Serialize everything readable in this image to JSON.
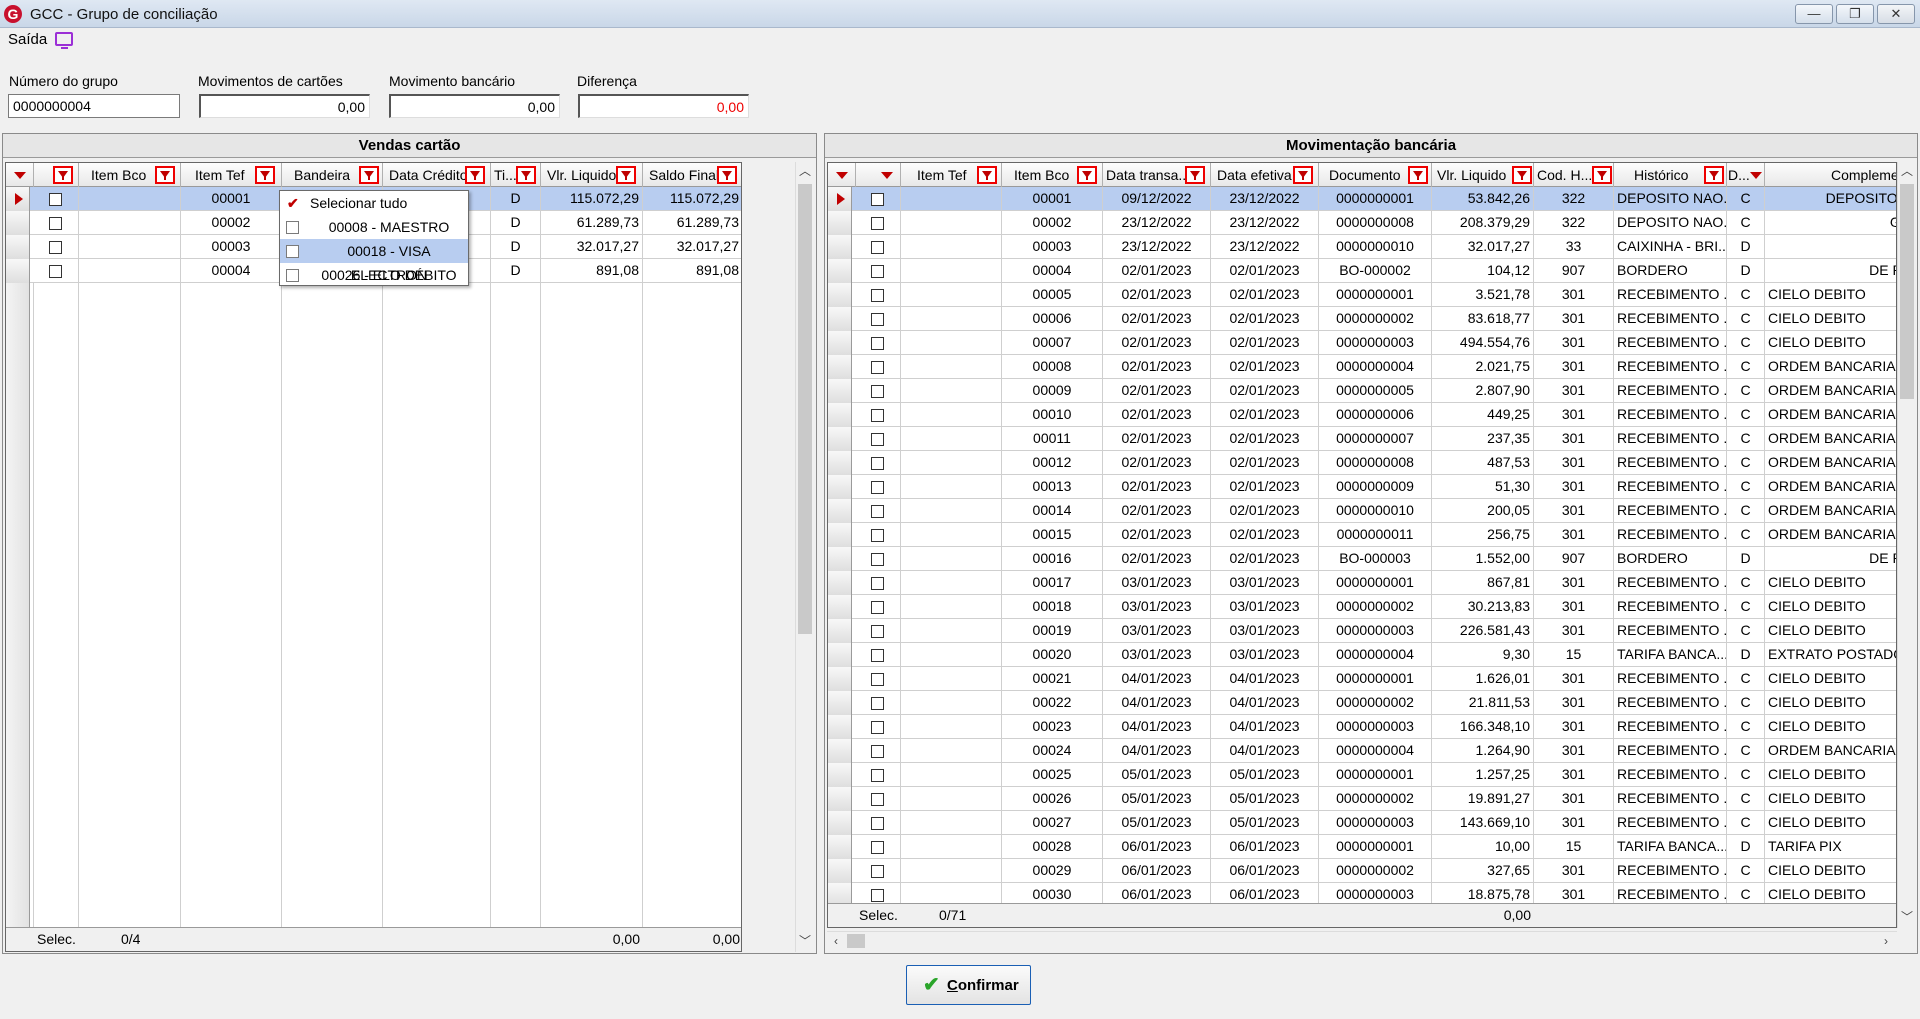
{
  "window": {
    "logo": "G",
    "title": "GCC - Grupo de conciliação",
    "controls": [
      "—",
      "❐",
      "✕"
    ]
  },
  "menu": {
    "saida": "Saída"
  },
  "fields": {
    "numero_label": "Número do grupo",
    "numero_value": "0000000004",
    "mov_cartoes_label": "Movimentos de cartões",
    "mov_cartoes_value": "0,00",
    "mov_bancario_label": "Movimento bancário",
    "mov_bancario_value": "0,00",
    "diferenca_label": "Diferença",
    "diferenca_value": "0,00"
  },
  "vendas": {
    "title": "Vendas cartão",
    "columns": [
      "Item Bco",
      "Item Tef",
      "Bandeira",
      "Data Crédito",
      "Ti...",
      "Vlr. Liquido",
      "Saldo Final"
    ],
    "rows": [
      {
        "item_tef": "00001",
        "tipo": "D",
        "vlr": "115.072,29",
        "saldo": "115.072,29"
      },
      {
        "item_tef": "00002",
        "tipo": "D",
        "vlr": "61.289,73",
        "saldo": "61.289,73"
      },
      {
        "item_tef": "00003",
        "tipo": "D",
        "vlr": "32.017,27",
        "saldo": "32.017,27"
      },
      {
        "item_tef": "00004",
        "tipo": "D",
        "vlr": "891,08",
        "saldo": "891,08"
      }
    ],
    "footer": {
      "selec": "Selec.",
      "count": "0/4",
      "vlr": "0,00",
      "saldo": "0,00"
    }
  },
  "bandeira_filter": {
    "items": [
      "Selecionar tudo",
      "00008 - MAESTRO",
      "00018 - VISA ELECTRON",
      "00026 - ELO DÉBITO"
    ],
    "check_mark": "✔"
  },
  "bancaria": {
    "title": "Movimentação bancária",
    "columns": [
      "Item Tef",
      "Item Bco",
      "Data transa...",
      "Data efetiva",
      "Documento",
      "Vlr. Liquido",
      "Cod. H...",
      "Histórico",
      "D...",
      "Complemen"
    ],
    "rows": [
      {
        "item": "00001",
        "dt": "09/12/2022",
        "de": "23/12/2022",
        "doc": "0000000001",
        "vlr": "53.842,26",
        "cod": "322",
        "hist": "DEPOSITO NAO...",
        "dc": "C",
        "comp": "DEPOSITO NÃ"
      },
      {
        "item": "00002",
        "dt": "23/12/2022",
        "de": "23/12/2022",
        "doc": "0000000008",
        "vlr": "208.379,29",
        "cod": "322",
        "hist": "DEPOSITO NAO...",
        "dc": "C",
        "comp": "GCC"
      },
      {
        "item": "00003",
        "dt": "23/12/2022",
        "de": "23/12/2022",
        "doc": "0000000010",
        "vlr": "32.017,27",
        "cod": "33",
        "hist": "CAIXINHA - BRI...",
        "dc": "D",
        "comp": ""
      },
      {
        "item": "00004",
        "dt": "02/01/2023",
        "de": "02/01/2023",
        "doc": "BO-000002",
        "vlr": "104,12",
        "cod": "907",
        "hist": "BORDERO",
        "dc": "D",
        "comp": "DE PAG"
      },
      {
        "item": "00005",
        "dt": "02/01/2023",
        "de": "02/01/2023",
        "doc": "0000000001",
        "vlr": "3.521,78",
        "cod": "301",
        "hist": "RECEBIMENTO ...",
        "dc": "C",
        "comp": "CIELO DEBITO"
      },
      {
        "item": "00006",
        "dt": "02/01/2023",
        "de": "02/01/2023",
        "doc": "0000000002",
        "vlr": "83.618,77",
        "cod": "301",
        "hist": "RECEBIMENTO ...",
        "dc": "C",
        "comp": "CIELO DEBITO"
      },
      {
        "item": "00007",
        "dt": "02/01/2023",
        "de": "02/01/2023",
        "doc": "0000000003",
        "vlr": "494.554,76",
        "cod": "301",
        "hist": "RECEBIMENTO ...",
        "dc": "C",
        "comp": "CIELO DEBITO"
      },
      {
        "item": "00008",
        "dt": "02/01/2023",
        "de": "02/01/2023",
        "doc": "0000000004",
        "vlr": "2.021,75",
        "cod": "301",
        "hist": "RECEBIMENTO ...",
        "dc": "C",
        "comp": "ORDEM BANCARIA"
      },
      {
        "item": "00009",
        "dt": "02/01/2023",
        "de": "02/01/2023",
        "doc": "0000000005",
        "vlr": "2.807,90",
        "cod": "301",
        "hist": "RECEBIMENTO ...",
        "dc": "C",
        "comp": "ORDEM BANCARIA"
      },
      {
        "item": "00010",
        "dt": "02/01/2023",
        "de": "02/01/2023",
        "doc": "0000000006",
        "vlr": "449,25",
        "cod": "301",
        "hist": "RECEBIMENTO ...",
        "dc": "C",
        "comp": "ORDEM BANCARIA"
      },
      {
        "item": "00011",
        "dt": "02/01/2023",
        "de": "02/01/2023",
        "doc": "0000000007",
        "vlr": "237,35",
        "cod": "301",
        "hist": "RECEBIMENTO ...",
        "dc": "C",
        "comp": "ORDEM BANCARIA"
      },
      {
        "item": "00012",
        "dt": "02/01/2023",
        "de": "02/01/2023",
        "doc": "0000000008",
        "vlr": "487,53",
        "cod": "301",
        "hist": "RECEBIMENTO ...",
        "dc": "C",
        "comp": "ORDEM BANCARIA"
      },
      {
        "item": "00013",
        "dt": "02/01/2023",
        "de": "02/01/2023",
        "doc": "0000000009",
        "vlr": "51,30",
        "cod": "301",
        "hist": "RECEBIMENTO ...",
        "dc": "C",
        "comp": "ORDEM BANCARIA"
      },
      {
        "item": "00014",
        "dt": "02/01/2023",
        "de": "02/01/2023",
        "doc": "0000000010",
        "vlr": "200,05",
        "cod": "301",
        "hist": "RECEBIMENTO ...",
        "dc": "C",
        "comp": "ORDEM BANCARIA"
      },
      {
        "item": "00015",
        "dt": "02/01/2023",
        "de": "02/01/2023",
        "doc": "0000000011",
        "vlr": "256,75",
        "cod": "301",
        "hist": "RECEBIMENTO ...",
        "dc": "C",
        "comp": "ORDEM BANCARIA"
      },
      {
        "item": "00016",
        "dt": "02/01/2023",
        "de": "02/01/2023",
        "doc": "BO-000003",
        "vlr": "1.552,00",
        "cod": "907",
        "hist": "BORDERO",
        "dc": "D",
        "comp": "DE PAG"
      },
      {
        "item": "00017",
        "dt": "03/01/2023",
        "de": "03/01/2023",
        "doc": "0000000001",
        "vlr": "867,81",
        "cod": "301",
        "hist": "RECEBIMENTO ...",
        "dc": "C",
        "comp": "CIELO DEBITO"
      },
      {
        "item": "00018",
        "dt": "03/01/2023",
        "de": "03/01/2023",
        "doc": "0000000002",
        "vlr": "30.213,83",
        "cod": "301",
        "hist": "RECEBIMENTO ...",
        "dc": "C",
        "comp": "CIELO DEBITO"
      },
      {
        "item": "00019",
        "dt": "03/01/2023",
        "de": "03/01/2023",
        "doc": "0000000003",
        "vlr": "226.581,43",
        "cod": "301",
        "hist": "RECEBIMENTO ...",
        "dc": "C",
        "comp": "CIELO DEBITO"
      },
      {
        "item": "00020",
        "dt": "03/01/2023",
        "de": "03/01/2023",
        "doc": "0000000004",
        "vlr": "9,30",
        "cod": "15",
        "hist": "TARIFA BANCA...",
        "dc": "D",
        "comp": "EXTRATO POSTADO"
      },
      {
        "item": "00021",
        "dt": "04/01/2023",
        "de": "04/01/2023",
        "doc": "0000000001",
        "vlr": "1.626,01",
        "cod": "301",
        "hist": "RECEBIMENTO ...",
        "dc": "C",
        "comp": "CIELO DEBITO"
      },
      {
        "item": "00022",
        "dt": "04/01/2023",
        "de": "04/01/2023",
        "doc": "0000000002",
        "vlr": "21.811,53",
        "cod": "301",
        "hist": "RECEBIMENTO ...",
        "dc": "C",
        "comp": "CIELO DEBITO"
      },
      {
        "item": "00023",
        "dt": "04/01/2023",
        "de": "04/01/2023",
        "doc": "0000000003",
        "vlr": "166.348,10",
        "cod": "301",
        "hist": "RECEBIMENTO ...",
        "dc": "C",
        "comp": "CIELO DEBITO"
      },
      {
        "item": "00024",
        "dt": "04/01/2023",
        "de": "04/01/2023",
        "doc": "0000000004",
        "vlr": "1.264,90",
        "cod": "301",
        "hist": "RECEBIMENTO ...",
        "dc": "C",
        "comp": "ORDEM BANCARIA"
      },
      {
        "item": "00025",
        "dt": "05/01/2023",
        "de": "05/01/2023",
        "doc": "0000000001",
        "vlr": "1.257,25",
        "cod": "301",
        "hist": "RECEBIMENTO ...",
        "dc": "C",
        "comp": "CIELO DEBITO"
      },
      {
        "item": "00026",
        "dt": "05/01/2023",
        "de": "05/01/2023",
        "doc": "0000000002",
        "vlr": "19.891,27",
        "cod": "301",
        "hist": "RECEBIMENTO ...",
        "dc": "C",
        "comp": "CIELO DEBITO"
      },
      {
        "item": "00027",
        "dt": "05/01/2023",
        "de": "05/01/2023",
        "doc": "0000000003",
        "vlr": "143.669,10",
        "cod": "301",
        "hist": "RECEBIMENTO ...",
        "dc": "C",
        "comp": "CIELO DEBITO"
      },
      {
        "item": "00028",
        "dt": "06/01/2023",
        "de": "06/01/2023",
        "doc": "0000000001",
        "vlr": "10,00",
        "cod": "15",
        "hist": "TARIFA BANCA...",
        "dc": "D",
        "comp": "TARIFA PIX"
      },
      {
        "item": "00029",
        "dt": "06/01/2023",
        "de": "06/01/2023",
        "doc": "0000000002",
        "vlr": "327,65",
        "cod": "301",
        "hist": "RECEBIMENTO ...",
        "dc": "C",
        "comp": "CIELO DEBITO"
      },
      {
        "item": "00030",
        "dt": "06/01/2023",
        "de": "06/01/2023",
        "doc": "0000000003",
        "vlr": "18.875,78",
        "cod": "301",
        "hist": "RECEBIMENTO ...",
        "dc": "C",
        "comp": "CIELO DEBITO"
      }
    ],
    "footer": {
      "selec": "Selec.",
      "count": "0/71",
      "vlr": "0,00"
    }
  },
  "confirm": {
    "label": "Confirmar",
    "icon": "✔"
  },
  "colors": {
    "accent_red": "#c00000",
    "selection": "#b8cdf0",
    "diff_red": "#e00000"
  }
}
